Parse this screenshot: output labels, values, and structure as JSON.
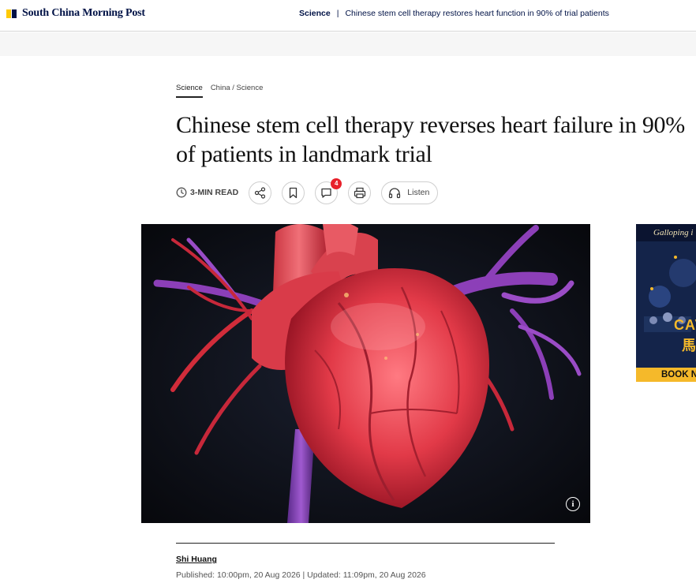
{
  "header": {
    "logo_text": "South China Morning Post",
    "section": "Science",
    "separator": "|",
    "article_title": "Chinese stem cell therapy restores heart function in 90% of trial patients"
  },
  "article": {
    "section_tag": "Science",
    "sub_tags": "China / Science",
    "headline": "Chinese stem cell therapy reverses heart failure in 90% of patients in landmark trial",
    "read_time": "3-MIN READ",
    "comment_count": "4",
    "listen_label": "Listen",
    "author": "Shi Huang",
    "published": "Published: 10:00pm, 20 Aug 2026 | Updated: 11:09pm, 20 Aug 2026"
  },
  "hero": {
    "info_glyph": "i"
  },
  "ad": {
    "headline": "Galloping i",
    "big_text": "CAV",
    "cn_text": "馬",
    "cta": "BOOK N"
  },
  "colors": {
    "brand_navy": "#001246",
    "brand_yellow": "#ffca05",
    "badge_red": "#e8202a"
  },
  "icons": [
    "clock-icon",
    "share-icon",
    "bookmark-icon",
    "comment-icon",
    "print-icon",
    "headphones-icon",
    "info-icon"
  ]
}
